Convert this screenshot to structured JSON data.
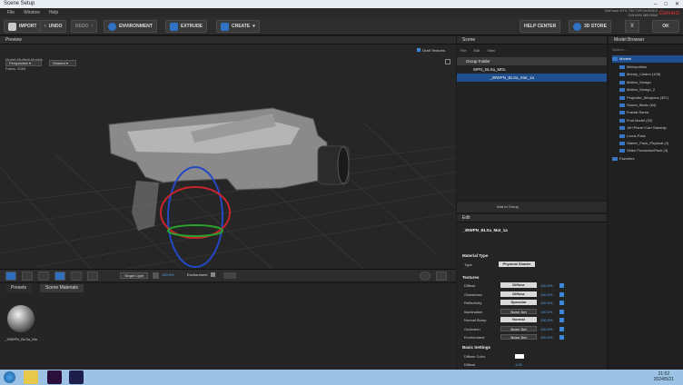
{
  "window": {
    "title": "Scene Setup",
    "menu": [
      "File",
      "Window",
      "Help"
    ],
    "gpu_lines": [
      "GeForce GTX 750 Ti/PCIe/SSE2",
      "2401000 MB RAM"
    ],
    "red_tag": "Connect"
  },
  "toolbar": {
    "import": "IMPORT",
    "undo": "UNDO",
    "redo": "REDO",
    "environment": "ENVIRONMENT",
    "extrude": "EXTRUDE",
    "create": "CREATE",
    "help": "HELP CENTER",
    "store": "3D STORE",
    "close": "X",
    "ok": "OK"
  },
  "viewport": {
    "title": "Preview",
    "view": "Perspective",
    "shade": "Shaded",
    "draft": "Draft Textures",
    "info": [
      {
        "k": "Model:",
        "v": "Multiple Models"
      },
      {
        "k": "Vertices:",
        "v": "8282"
      },
      {
        "k": "Faces:",
        "v": "2084"
      }
    ],
    "light": "Single Light",
    "light_pct": "100.0%",
    "env": "Environment"
  },
  "bottom": {
    "tabs": [
      "Presets",
      "Scene Materials"
    ],
    "material": "_39WPN_BLSa_Ma"
  },
  "scene": {
    "title": "Scene",
    "menu": [
      "File",
      "Edit",
      "View"
    ],
    "group": "Group Folder",
    "model": "WPN_BLSa_MDL",
    "mat": "_39WPN_BLSa_Mat_1a",
    "add_group": "Add to Group"
  },
  "edit": {
    "title": "Edit",
    "mat_name": "_39WPN_BLSa_Mat_1a",
    "material_type_label": "Material Type",
    "type_label": "Type",
    "type_value": "Physical Shader",
    "textures_label": "Textures",
    "rows": [
      {
        "n": "Diffuse",
        "v": "Diffuse",
        "p": "100.0%",
        "dark": false
      },
      {
        "n": "Glossiness",
        "v": "Diffuse",
        "p": "100.0%",
        "dark": false
      },
      {
        "n": "Reflectivity",
        "v": "Specular",
        "p": "100.0%",
        "dark": false
      },
      {
        "n": "Illumination",
        "v": "None Set",
        "p": "100.0%",
        "dark": true
      },
      {
        "n": "Normal Bump",
        "v": "Normal",
        "p": "100.0%",
        "dark": false
      },
      {
        "n": "Occlusion",
        "v": "None Set",
        "p": "100.0%",
        "dark": true
      },
      {
        "n": "Environment",
        "v": "None Set",
        "p": "100.0%",
        "dark": true
      }
    ],
    "basic_label": "Basic Settings",
    "diffuse_color": "Diffuse Color",
    "diffuse_label": "Diffuse",
    "diffuse_value": "1.00"
  },
  "browser": {
    "title": "Model Browser",
    "search": "Search...",
    "root": "Models",
    "items": [
      "Metropolitan",
      "Money_Casino (108)",
      "Motion_Design",
      "Motion_Design_2",
      "Projectile_Weapons (307)",
      "Sound_Music (84)",
      "Fractal Rama",
      "Fruit Model (20)",
      "Jet+Plane+Car+Starship",
      "Locus Pack",
      "Starter_Pack_Physical (4)",
      "Video ProductionPack (3)"
    ],
    "favorites": "Favorites"
  },
  "taskbar": {
    "time": "21:02",
    "date": "2024/5/21"
  },
  "colors": {
    "accent": "#2f72c4",
    "selection": "#1f4f8f"
  }
}
